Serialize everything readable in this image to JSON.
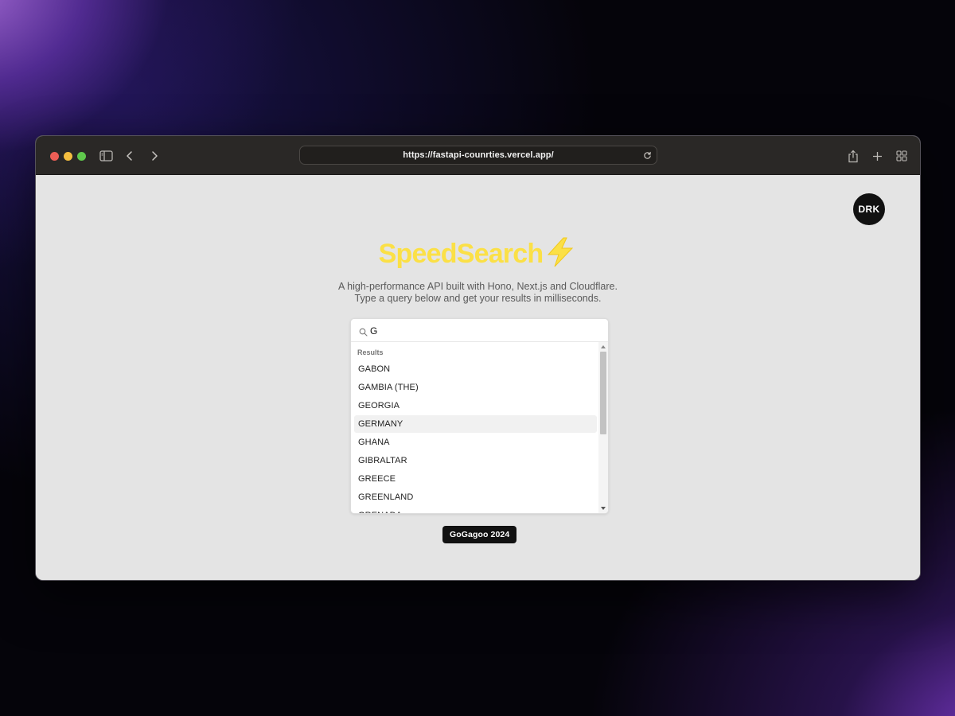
{
  "browser": {
    "url": "https://fastapi-counrties.vercel.app/",
    "icons": [
      "sidebar-icon",
      "back-chevron-icon",
      "forward-chevron-icon",
      "reload-icon",
      "share-icon",
      "plus-icon",
      "tabs-grid-icon"
    ]
  },
  "header": {
    "avatar_label": "DRK"
  },
  "hero": {
    "title": "SpeedSearch",
    "title_color": "#fbe046",
    "subtitle_line1": "A high-performance API built with Hono, Next.js and Cloudflare.",
    "subtitle_line2": "Type a query below and get your results in milliseconds."
  },
  "search": {
    "value": "G",
    "results_heading": "Results",
    "results": [
      "GABON",
      "GAMBIA (THE)",
      "GEORGIA",
      "GERMANY",
      "GHANA",
      "GIBRALTAR",
      "GREECE",
      "GREENLAND",
      "GRENADA"
    ],
    "active_index": 3
  },
  "footer": {
    "badge": "GoGagoo 2024"
  }
}
